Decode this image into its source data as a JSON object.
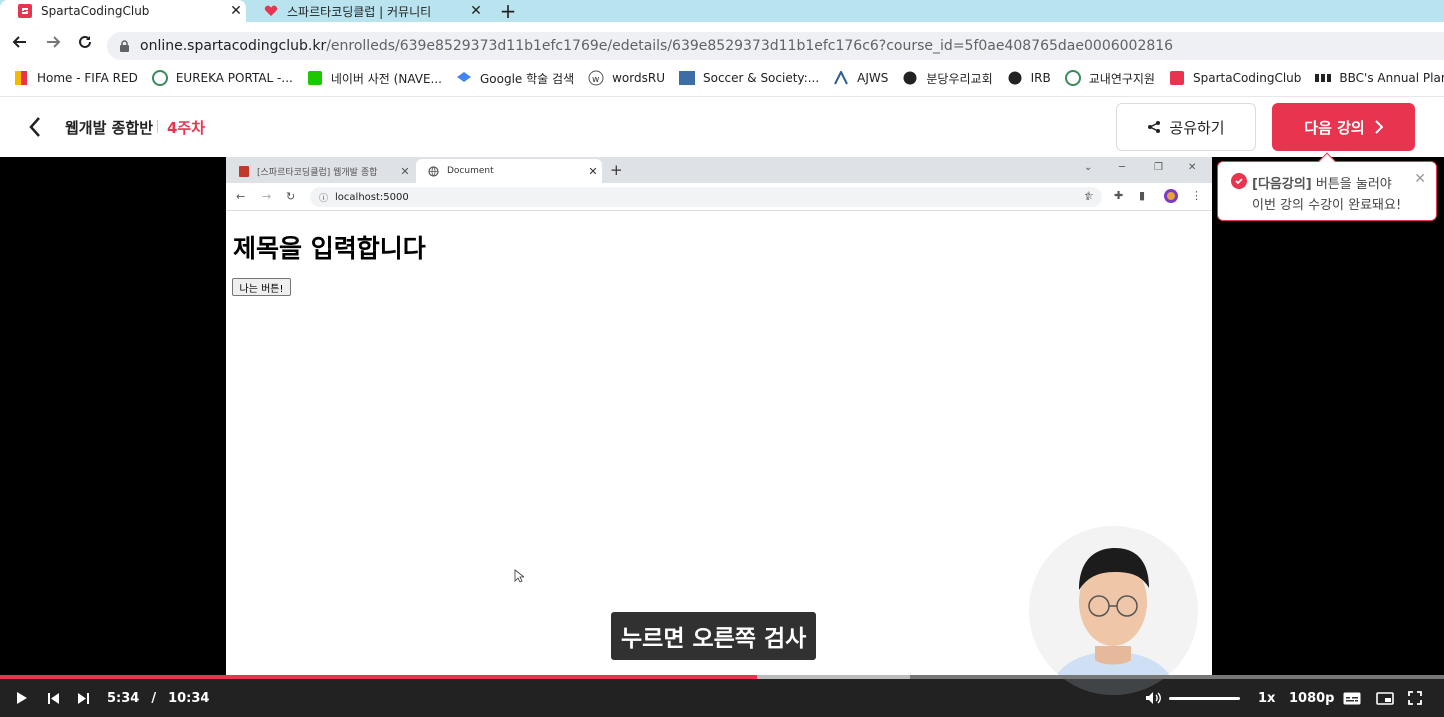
{
  "browser": {
    "tabs": [
      {
        "title": "SpartaCodingClub",
        "active": true
      },
      {
        "title": "스파르타코딩클럽 | 커뮤니티",
        "active": false
      }
    ],
    "url": {
      "host": "online.spartacodingclub.kr",
      "path": "/enrolleds/639e8529373d11b1efc1769e/edetails/639e8529373d11b1efc176c6?course_id=5f0ae408765dae0006002816"
    },
    "bookmarks": [
      "Home - FIFA RED",
      "EUREKA PORTAL -...",
      "네이버 사전 (NAVE...",
      "Google 학술 검색",
      "wordsRU",
      "Soccer & Society:...",
      "AJWS",
      "분당우리교회",
      "IRB",
      "교내연구지원",
      "SpartaCodingClub",
      "BBC's Annual Plan..."
    ]
  },
  "course": {
    "title": "웹개발 종합반",
    "week": "4주차",
    "share_label": "공유하기",
    "next_label": "다음 강의"
  },
  "tooltip": {
    "bold": "[다음강의]",
    "line1_rest": " 버튼을 눌러야",
    "line2": "이번 강의 수강이 완료돼요!"
  },
  "inner_browser": {
    "tabs": [
      {
        "title": "[스파르타코딩클럽] 웹개발 종합",
        "active": false
      },
      {
        "title": "Document",
        "active": true
      }
    ],
    "url": "localhost:5000",
    "page": {
      "heading": "제목을 입력합니다",
      "button_label": "나는 버튼!"
    }
  },
  "video": {
    "subtitle": "누르면 오른쪽 검사",
    "current_time": "5:34",
    "time_separator": "/",
    "duration": "10:34",
    "played_fraction": 0.524,
    "speed": "1x",
    "quality": "1080p"
  },
  "colors": {
    "accent": "#e8344e",
    "tabbar": "#b9e3ef"
  }
}
